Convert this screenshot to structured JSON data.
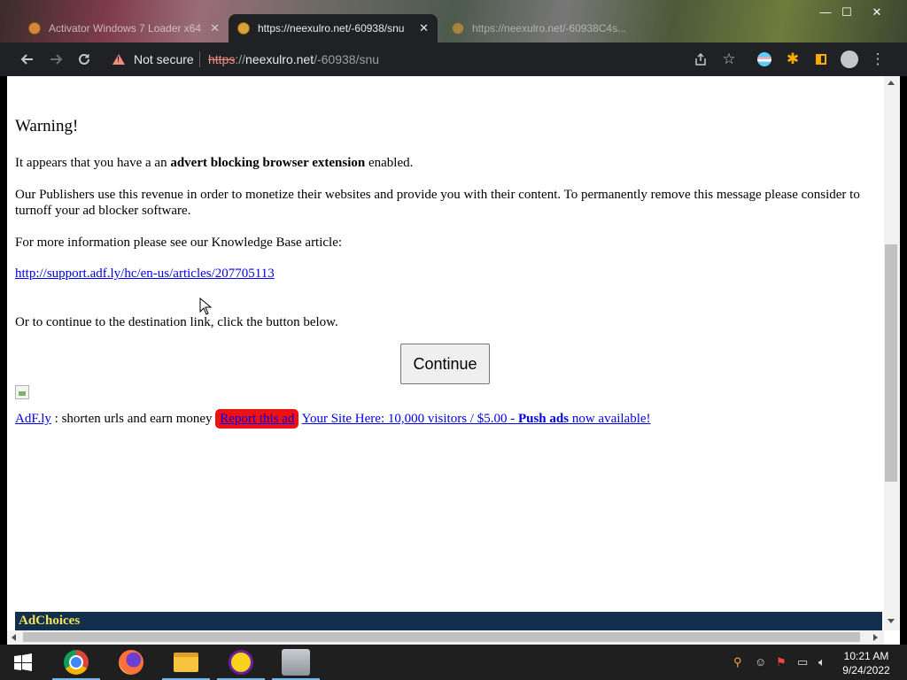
{
  "browser": {
    "tabs": [
      {
        "title": "Activator Windows 7 Loader x64",
        "active": false
      },
      {
        "title": "https://neexulro.net/-60938/snu",
        "active": true
      },
      {
        "title": "https://neexulro.net/-60938C4s...",
        "active": false
      }
    ],
    "security_label": "Not secure",
    "url": {
      "scheme": "https",
      "separator": "://",
      "host": "neexulro.net",
      "path": "/-60938/snu"
    }
  },
  "page": {
    "warning_title": "Warning!",
    "p1_before": "It appears that you have a an ",
    "p1_bold": "advert blocking browser extension",
    "p1_after": " enabled.",
    "p2": "Our Publishers use this revenue in order to monetize their websites and provide you with their content. To permanently remove this message please consider to turnoff your ad blocker software.",
    "p3": "For more information please see our Knowledge Base article:",
    "kb_link": "http://support.adf.ly/hc/en-us/articles/207705113",
    "p4": "Or to continue to the destination link, click the button below.",
    "continue_label": "Continue",
    "footer": {
      "adfly_link": "AdF.ly",
      "tagline": " : shorten urls and earn money ",
      "report_ad": "Report this ad",
      "promo_before": "Your Site Here: 10,000 visitors / $5.00 - ",
      "promo_bold": "Push ads",
      "promo_after": " now available!"
    },
    "adchoices": "AdChoices"
  },
  "taskbar": {
    "apps": [
      "windows-start",
      "chrome",
      "firefox",
      "file-explorer",
      "yahoo-messenger",
      "cat-app"
    ],
    "time": "10:21 AM",
    "date": "9/24/2022"
  },
  "colors": {
    "link": "#0000ee",
    "report_ad_bg": "#ee1111",
    "adchoices_bg": "#12304d",
    "adchoices_text": "#f3e35a"
  }
}
